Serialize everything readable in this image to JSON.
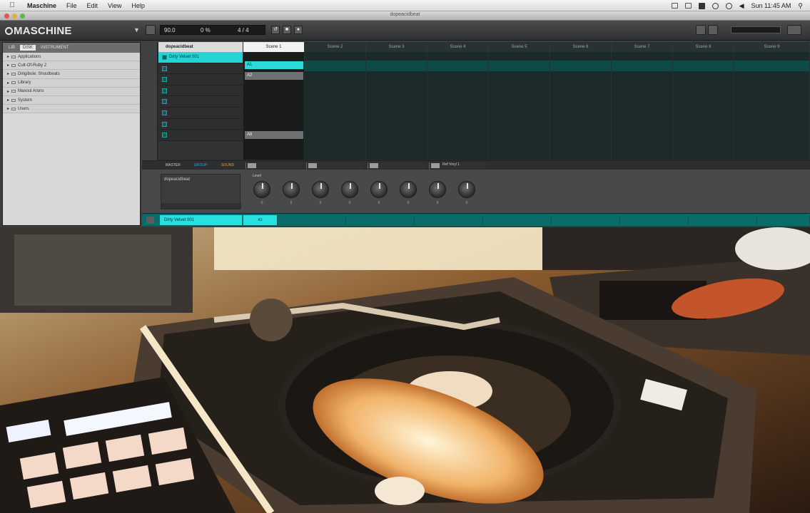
{
  "menubar": {
    "app": "Maschine",
    "items": [
      "File",
      "Edit",
      "View",
      "Help"
    ],
    "clock": "Sun 11:45 AM"
  },
  "window": {
    "title": "dopeacidbeat"
  },
  "header": {
    "logo": "MASCHINE",
    "tempo": "90.0",
    "swing": "0 %",
    "signature": "4 / 4"
  },
  "browser": {
    "tabs": [
      "LIB",
      "DISK",
      "INSTRUMENT"
    ],
    "items": [
      "Applications",
      "Cult-Of-Ruby 2",
      "Dirigibule: Shoutbeats",
      "Library",
      "Maxoul Arons",
      "System",
      "Users"
    ]
  },
  "arranger": {
    "project": "dopeacidbeat",
    "group_selected": "Dirty Velvet 001",
    "scenes": [
      "Scene 1",
      "Scene 2",
      "Scene 3",
      "Scene 4",
      "Scene 5",
      "Scene 6",
      "Scene 7",
      "Scene 8",
      "Scene 9"
    ],
    "clips": {
      "a1": "A1",
      "a2": "A2",
      "a8": "A8"
    }
  },
  "control": {
    "tabs": [
      "MASTER",
      "GROUP",
      "SOUND"
    ],
    "preset_name": "dopeacidbeat",
    "knob_label": "Level",
    "knob_values": [
      "0",
      "0",
      "0",
      "0",
      "0",
      "0",
      "0",
      "0"
    ],
    "slot_name": "Ref Vinyl 1"
  },
  "pattern_bar": {
    "group_name": "Dirty Velvet 001",
    "pattern": "A1"
  },
  "colors": {
    "accent_cyan": "#22d4d4",
    "panel": "#3b3d3e"
  }
}
